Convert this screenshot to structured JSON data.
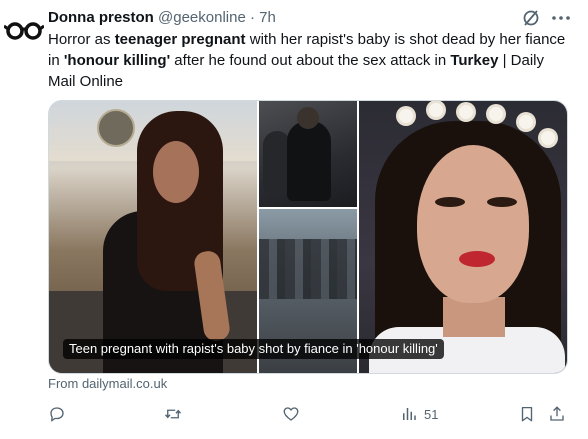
{
  "author": {
    "name": "Donna preston",
    "handle": "@geekonline",
    "separator": "·",
    "time": "7h",
    "avatar_icon": "glasses-avatar-icon"
  },
  "tweet": {
    "text_segments": [
      {
        "text": "Horror as ",
        "bold": false
      },
      {
        "text": "teenager pregnant",
        "bold": true
      },
      {
        "text": " with her rapist's baby is shot dead by her fiance in ",
        "bold": false
      },
      {
        "text": "'honour killing'",
        "bold": true
      },
      {
        "text": " after he found out about the sex attack in ",
        "bold": false
      },
      {
        "text": "Turkey",
        "bold": true
      },
      {
        "text": " | Daily Mail Online",
        "bold": false
      }
    ]
  },
  "card": {
    "caption": "Teen pregnant with rapist's baby shot by fiance in 'honour killing'",
    "source": "From dailymail.co.uk"
  },
  "actions": {
    "reply_icon": "reply-icon",
    "retweet_icon": "retweet-icon",
    "like_icon": "heart-icon",
    "views_icon": "views-icon",
    "views_count": "51",
    "bookmark_icon": "bookmark-icon",
    "share_icon": "share-icon"
  },
  "colors": {
    "text": "#0f1419",
    "secondary": "#536471",
    "border": "#cfd9de",
    "background": "#ffffff"
  }
}
